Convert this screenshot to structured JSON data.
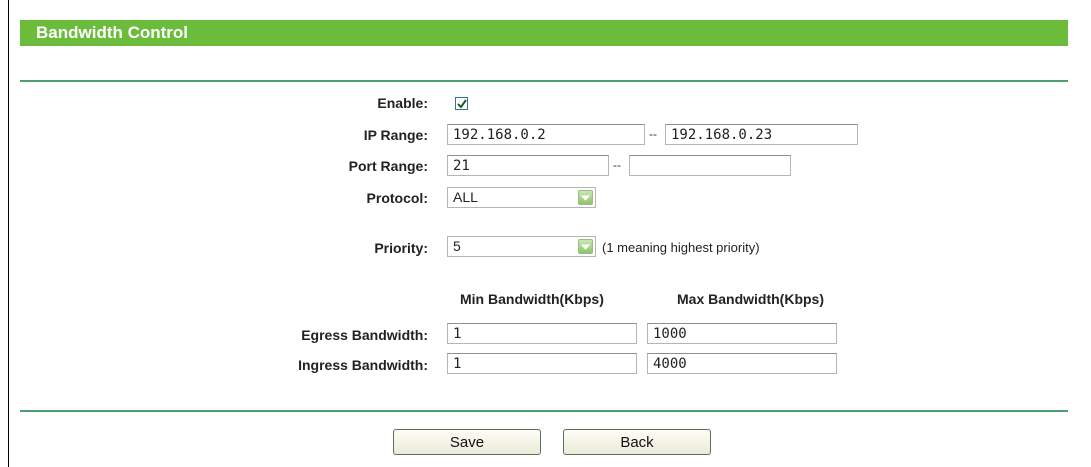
{
  "title": "Bandwidth Control",
  "form": {
    "enable": {
      "label": "Enable:",
      "checked": true
    },
    "ip_range": {
      "label": "IP Range:",
      "start": "192.168.0.2",
      "separator": "--",
      "end": "192.168.0.23"
    },
    "port_range": {
      "label": "Port Range:",
      "start": "21",
      "separator": "--",
      "end": ""
    },
    "protocol": {
      "label": "Protocol:",
      "selected": "ALL"
    },
    "priority": {
      "label": "Priority:",
      "selected": "5",
      "note": "(1 meaning highest priority)"
    },
    "bandwidth": {
      "min_header": "Min Bandwidth(Kbps)",
      "max_header": "Max Bandwidth(Kbps)",
      "egress": {
        "label": "Egress Bandwidth:",
        "min": "1",
        "max": "1000"
      },
      "ingress": {
        "label": "Ingress Bandwidth:",
        "min": "1",
        "max": "4000"
      }
    }
  },
  "buttons": {
    "save": "Save",
    "back": "Back"
  },
  "colors": {
    "title_bar": "#6abc3a",
    "rule": "#4c9e6e",
    "dropdown_arrow": "#8ec56a"
  },
  "icons": {
    "checkbox": "checkmark-icon",
    "dropdown": "chevron-down-icon"
  }
}
